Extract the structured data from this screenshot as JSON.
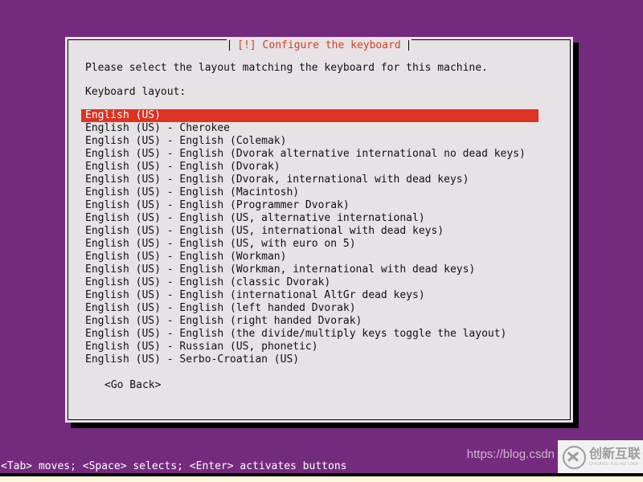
{
  "screen": {
    "background_color": "#752b7d",
    "bottom_strip_color": "#fbf8dd"
  },
  "dialog": {
    "title": "[!] Configure the keyboard",
    "title_color": "#d93f1e",
    "background_color": "#e6e2e6",
    "prompt": "Please select the layout matching the keyboard for this machine.",
    "layout_label": "Keyboard layout:",
    "selected_index": 0,
    "selection_color": "#dc3323",
    "layouts": [
      "English (US)",
      "English (US) - Cherokee",
      "English (US) - English (Colemak)",
      "English (US) - English (Dvorak alternative international no dead keys)",
      "English (US) - English (Dvorak)",
      "English (US) - English (Dvorak, international with dead keys)",
      "English (US) - English (Macintosh)",
      "English (US) - English (Programmer Dvorak)",
      "English (US) - English (US, alternative international)",
      "English (US) - English (US, international with dead keys)",
      "English (US) - English (US, with euro on 5)",
      "English (US) - English (Workman)",
      "English (US) - English (Workman, international with dead keys)",
      "English (US) - English (classic Dvorak)",
      "English (US) - English (international AltGr dead keys)",
      "English (US) - English (left handed Dvorak)",
      "English (US) - English (right handed Dvorak)",
      "English (US) - English (the divide/multiply keys toggle the layout)",
      "English (US) - Russian (US, phonetic)",
      "English (US) - Serbo-Croatian (US)"
    ],
    "go_back": "<Go Back>"
  },
  "helpbar": {
    "text": "<Tab> moves; <Space> selects; <Enter> activates buttons",
    "text_color": "#ffffff"
  },
  "watermark": {
    "url": "https://blog.csdn",
    "logo_cn": "创新互联",
    "logo_pinyin": "CHUANG XIN HU LIAN"
  }
}
